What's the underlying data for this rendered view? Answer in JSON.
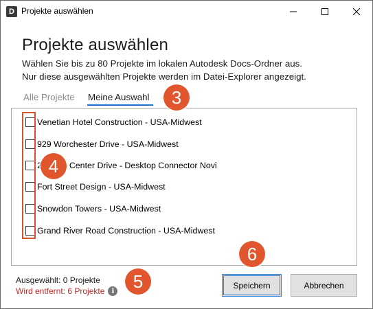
{
  "window": {
    "icon_letter": "D",
    "title": "Projekte auswählen"
  },
  "dialog": {
    "heading": "Projekte auswählen",
    "description_line1": "Wählen Sie bis zu 80 Projekte im lokalen Autodesk Docs-Ordner aus.",
    "description_line2": "Nur diese ausgewählten Projekte werden im Datei-Explorer angezeigt."
  },
  "tabs": [
    {
      "label": "Alle Projekte",
      "active": false
    },
    {
      "label": "Meine Auswahl",
      "active": true
    }
  ],
  "projects": [
    {
      "label": "Venetian Hotel Construction - USA-Midwest",
      "checked": false
    },
    {
      "label": "929 Worchester Drive - USA-Midwest",
      "checked": false
    },
    {
      "label": "2    own Center Drive - Desktop Connector Novi",
      "checked": false
    },
    {
      "label": "Fort Street Design - USA-Midwest",
      "checked": false
    },
    {
      "label": "Snowdon Towers - USA-Midwest",
      "checked": false
    },
    {
      "label": "Grand River Road Construction - USA-Midwest",
      "checked": false
    }
  ],
  "status": {
    "selected": "Ausgewählt: 0 Projekte",
    "removed": "Wird entfernt: 6 Projekte",
    "info_glyph": "i"
  },
  "buttons": {
    "save": "Speichern",
    "cancel": "Abbrechen"
  },
  "callouts": {
    "tabs": "3",
    "checkboxes": "4",
    "status": "5",
    "save": "6"
  },
  "colors": {
    "callout": "#e2562d",
    "tab_underline": "#1f6fd1",
    "removed_text": "#c62828"
  }
}
